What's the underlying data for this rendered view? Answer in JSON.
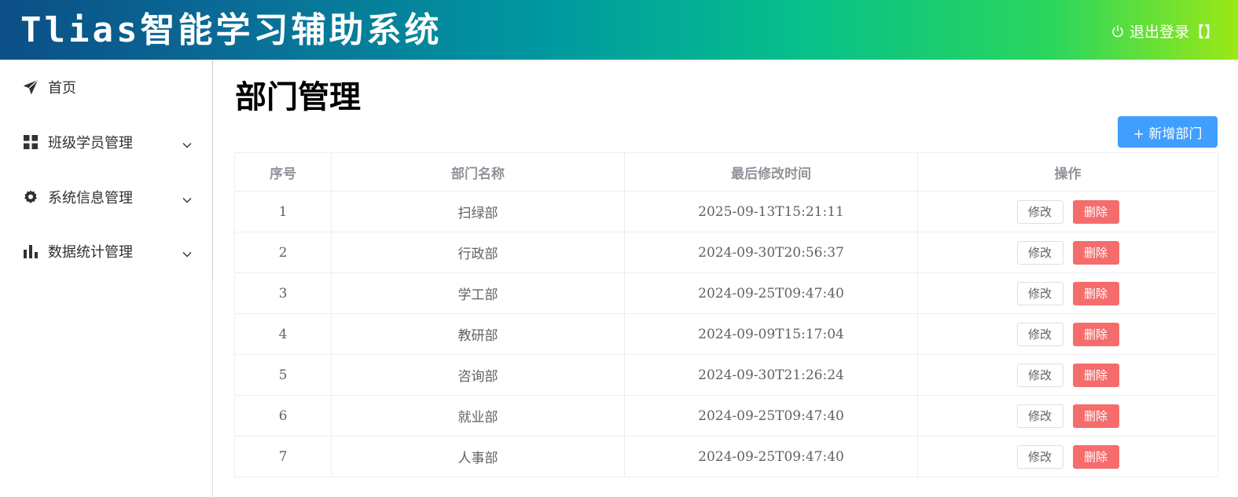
{
  "header": {
    "app_title": "Tlias智能学习辅助系统",
    "logout_label": "退出登录【】",
    "colors": {
      "gradient_start": "#0b4f86",
      "gradient_mid": "#07c08a",
      "gradient_end": "#9be816"
    }
  },
  "sidebar": {
    "items": [
      {
        "label": "首页",
        "icon": "paper-plane-icon",
        "expandable": false
      },
      {
        "label": "班级学员管理",
        "icon": "grid-icon",
        "expandable": true
      },
      {
        "label": "系统信息管理",
        "icon": "gear-icon",
        "expandable": true
      },
      {
        "label": "数据统计管理",
        "icon": "bar-chart-icon",
        "expandable": true
      }
    ]
  },
  "main": {
    "title": "部门管理",
    "add_button_label": "+ 新增部门",
    "table": {
      "columns": [
        "序号",
        "部门名称",
        "最后修改时间",
        "操作"
      ],
      "edit_label": "修改",
      "delete_label": "删除",
      "rows": [
        {
          "index": "1",
          "name": "扫绿部",
          "updated": "2025-09-13T15:21:11"
        },
        {
          "index": "2",
          "name": "行政部",
          "updated": "2024-09-30T20:56:37"
        },
        {
          "index": "3",
          "name": "学工部",
          "updated": "2024-09-25T09:47:40"
        },
        {
          "index": "4",
          "name": "教研部",
          "updated": "2024-09-09T15:17:04"
        },
        {
          "index": "5",
          "name": "咨询部",
          "updated": "2024-09-30T21:26:24"
        },
        {
          "index": "6",
          "name": "就业部",
          "updated": "2024-09-25T09:47:40"
        },
        {
          "index": "7",
          "name": "人事部",
          "updated": "2024-09-25T09:47:40"
        }
      ]
    },
    "colors": {
      "primary": "#409eff",
      "danger": "#f56c6c"
    }
  }
}
